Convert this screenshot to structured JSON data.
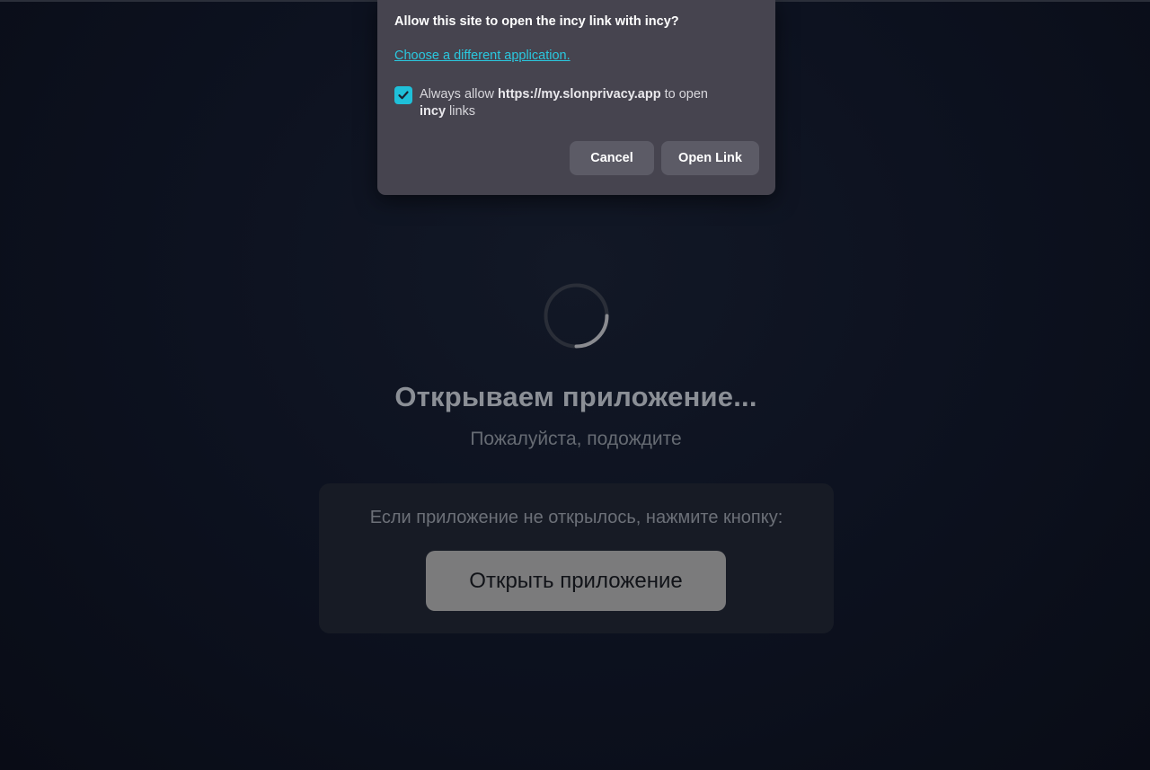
{
  "dialog": {
    "title": "Allow this site to open the incy link with incy?",
    "choose_link": "Choose a different application.",
    "always_allow_checked": true,
    "always_allow_prefix": "Always allow ",
    "site": "https://my.slonprivacy.app",
    "to_open": " to open ",
    "app_name": "incy",
    "links_suffix": " links",
    "cancel_label": "Cancel",
    "open_label": "Open Link"
  },
  "loading": {
    "title": "Открываем приложение...",
    "subtitle": "Пожалуйста, подождите",
    "spinner_icon": "loading-spinner-icon"
  },
  "fallback": {
    "text": "Если приложение не открылось, нажмите кнопку:",
    "button_label": "Открыть приложение"
  },
  "colors": {
    "background": "#0b0f1a",
    "dialog_bg": "#46444f",
    "accent": "#1fc0d9",
    "open_app_button": "#7b7b7c"
  }
}
